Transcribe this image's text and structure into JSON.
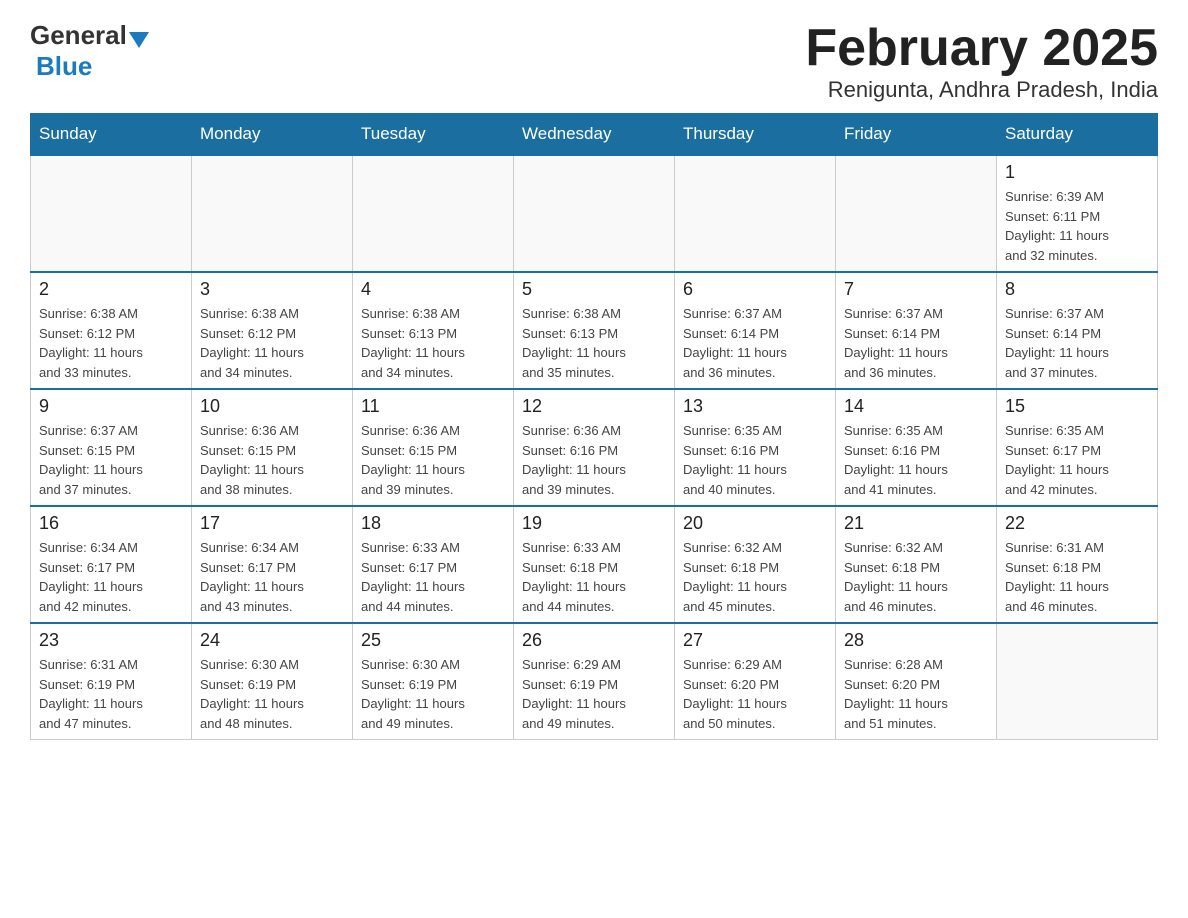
{
  "header": {
    "logo_general": "General",
    "logo_blue": "Blue",
    "month_title": "February 2025",
    "subtitle": "Renigunta, Andhra Pradesh, India"
  },
  "weekdays": [
    "Sunday",
    "Monday",
    "Tuesday",
    "Wednesday",
    "Thursday",
    "Friday",
    "Saturday"
  ],
  "weeks": [
    [
      {
        "day": "",
        "info": ""
      },
      {
        "day": "",
        "info": ""
      },
      {
        "day": "",
        "info": ""
      },
      {
        "day": "",
        "info": ""
      },
      {
        "day": "",
        "info": ""
      },
      {
        "day": "",
        "info": ""
      },
      {
        "day": "1",
        "info": "Sunrise: 6:39 AM\nSunset: 6:11 PM\nDaylight: 11 hours\nand 32 minutes."
      }
    ],
    [
      {
        "day": "2",
        "info": "Sunrise: 6:38 AM\nSunset: 6:12 PM\nDaylight: 11 hours\nand 33 minutes."
      },
      {
        "day": "3",
        "info": "Sunrise: 6:38 AM\nSunset: 6:12 PM\nDaylight: 11 hours\nand 34 minutes."
      },
      {
        "day": "4",
        "info": "Sunrise: 6:38 AM\nSunset: 6:13 PM\nDaylight: 11 hours\nand 34 minutes."
      },
      {
        "day": "5",
        "info": "Sunrise: 6:38 AM\nSunset: 6:13 PM\nDaylight: 11 hours\nand 35 minutes."
      },
      {
        "day": "6",
        "info": "Sunrise: 6:37 AM\nSunset: 6:14 PM\nDaylight: 11 hours\nand 36 minutes."
      },
      {
        "day": "7",
        "info": "Sunrise: 6:37 AM\nSunset: 6:14 PM\nDaylight: 11 hours\nand 36 minutes."
      },
      {
        "day": "8",
        "info": "Sunrise: 6:37 AM\nSunset: 6:14 PM\nDaylight: 11 hours\nand 37 minutes."
      }
    ],
    [
      {
        "day": "9",
        "info": "Sunrise: 6:37 AM\nSunset: 6:15 PM\nDaylight: 11 hours\nand 37 minutes."
      },
      {
        "day": "10",
        "info": "Sunrise: 6:36 AM\nSunset: 6:15 PM\nDaylight: 11 hours\nand 38 minutes."
      },
      {
        "day": "11",
        "info": "Sunrise: 6:36 AM\nSunset: 6:15 PM\nDaylight: 11 hours\nand 39 minutes."
      },
      {
        "day": "12",
        "info": "Sunrise: 6:36 AM\nSunset: 6:16 PM\nDaylight: 11 hours\nand 39 minutes."
      },
      {
        "day": "13",
        "info": "Sunrise: 6:35 AM\nSunset: 6:16 PM\nDaylight: 11 hours\nand 40 minutes."
      },
      {
        "day": "14",
        "info": "Sunrise: 6:35 AM\nSunset: 6:16 PM\nDaylight: 11 hours\nand 41 minutes."
      },
      {
        "day": "15",
        "info": "Sunrise: 6:35 AM\nSunset: 6:17 PM\nDaylight: 11 hours\nand 42 minutes."
      }
    ],
    [
      {
        "day": "16",
        "info": "Sunrise: 6:34 AM\nSunset: 6:17 PM\nDaylight: 11 hours\nand 42 minutes."
      },
      {
        "day": "17",
        "info": "Sunrise: 6:34 AM\nSunset: 6:17 PM\nDaylight: 11 hours\nand 43 minutes."
      },
      {
        "day": "18",
        "info": "Sunrise: 6:33 AM\nSunset: 6:17 PM\nDaylight: 11 hours\nand 44 minutes."
      },
      {
        "day": "19",
        "info": "Sunrise: 6:33 AM\nSunset: 6:18 PM\nDaylight: 11 hours\nand 44 minutes."
      },
      {
        "day": "20",
        "info": "Sunrise: 6:32 AM\nSunset: 6:18 PM\nDaylight: 11 hours\nand 45 minutes."
      },
      {
        "day": "21",
        "info": "Sunrise: 6:32 AM\nSunset: 6:18 PM\nDaylight: 11 hours\nand 46 minutes."
      },
      {
        "day": "22",
        "info": "Sunrise: 6:31 AM\nSunset: 6:18 PM\nDaylight: 11 hours\nand 46 minutes."
      }
    ],
    [
      {
        "day": "23",
        "info": "Sunrise: 6:31 AM\nSunset: 6:19 PM\nDaylight: 11 hours\nand 47 minutes."
      },
      {
        "day": "24",
        "info": "Sunrise: 6:30 AM\nSunset: 6:19 PM\nDaylight: 11 hours\nand 48 minutes."
      },
      {
        "day": "25",
        "info": "Sunrise: 6:30 AM\nSunset: 6:19 PM\nDaylight: 11 hours\nand 49 minutes."
      },
      {
        "day": "26",
        "info": "Sunrise: 6:29 AM\nSunset: 6:19 PM\nDaylight: 11 hours\nand 49 minutes."
      },
      {
        "day": "27",
        "info": "Sunrise: 6:29 AM\nSunset: 6:20 PM\nDaylight: 11 hours\nand 50 minutes."
      },
      {
        "day": "28",
        "info": "Sunrise: 6:28 AM\nSunset: 6:20 PM\nDaylight: 11 hours\nand 51 minutes."
      },
      {
        "day": "",
        "info": ""
      }
    ]
  ]
}
